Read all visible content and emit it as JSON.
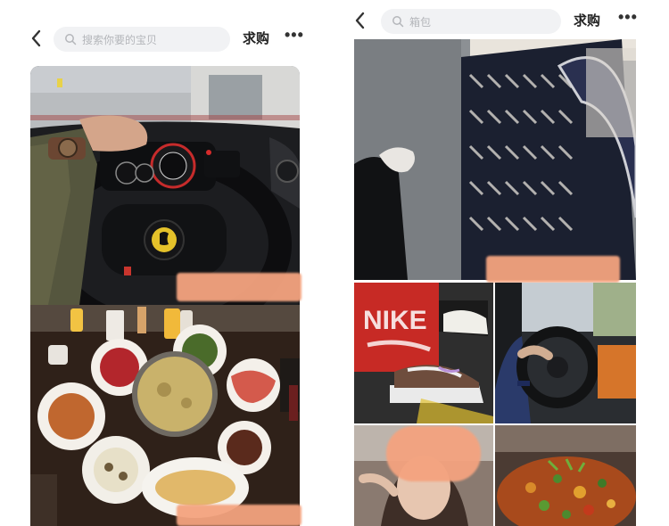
{
  "left_screen": {
    "back_icon": "chevron-left-icon",
    "search_placeholder": "搜索你要的宝贝",
    "qiugou_label": "求购",
    "more_label": "•••"
  },
  "right_screen": {
    "back_icon": "chevron-left-icon",
    "search_placeholder": "箱包",
    "qiugou_label": "求购",
    "more_label": "•••"
  },
  "photos": {
    "sneaker_box_brand": "NIKE"
  },
  "colors": {
    "search_bg": "#f1f2f4",
    "redaction": "#f4a37f",
    "ferrari_red": "#d62b2b"
  }
}
